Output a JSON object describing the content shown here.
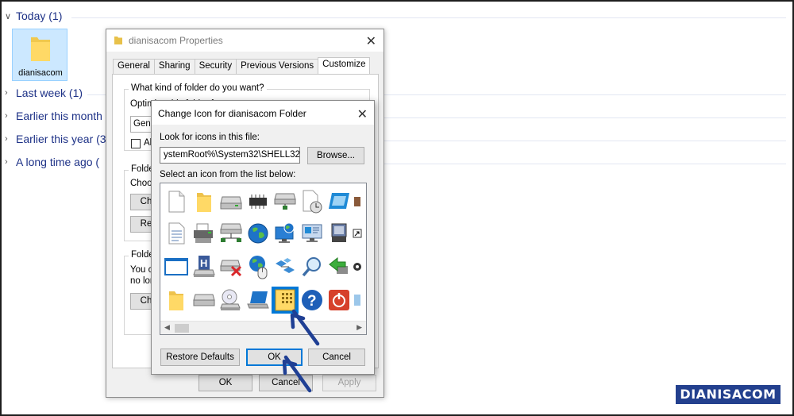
{
  "explorer": {
    "groups": [
      {
        "label": "Today (1)",
        "expanded": true
      },
      {
        "label": "Last week (1)",
        "expanded": false
      },
      {
        "label": "Earlier this month",
        "expanded": false
      },
      {
        "label": "Earlier this year (3",
        "expanded": false
      },
      {
        "label": "A long time ago (",
        "expanded": false
      }
    ],
    "folder": {
      "name": "dianisacom",
      "icon": "folder-icon"
    }
  },
  "properties": {
    "title": "dianisacom Properties",
    "tabs": [
      "General",
      "Sharing",
      "Security",
      "Previous Versions",
      "Customize"
    ],
    "active_tab": "Customize",
    "what_kind_label": "What kind of folder do you want?",
    "optimize_label": "Optimize this folder for:",
    "optimize_value": "General",
    "also_apply_label": "Also",
    "folder_pictures_label": "Folder",
    "choose_label": "Choos",
    "choose_file_button": "Ch",
    "restore_default_button": "Re",
    "folder_icons_label": "Folder",
    "folder_icons_text_1": "You c",
    "folder_icons_text_2": "no lon",
    "change_icon_button": "Ch",
    "ok_button": "OK",
    "cancel_button": "Cancel",
    "apply_button": "Apply"
  },
  "change_icon": {
    "title": "Change Icon for dianisacom Folder",
    "look_label": "Look for icons in this file:",
    "path_value": "ystemRoot%\\System32\\SHELL32.dll",
    "browse_button": "Browse...",
    "select_label": "Select an icon from the list below:",
    "selected_icon": "grid-folder-icon",
    "icons": [
      [
        "blank-file-icon",
        "folder-icon",
        "drive-icon",
        "chip-icon",
        "network-drive-icon",
        "clock-file-icon",
        "window-icon",
        "partial-icon"
      ],
      [
        "document-icon",
        "printer-icon",
        "network-icon",
        "globe-icon",
        "monitor-globe-icon",
        "display-icon",
        "computer-icon",
        "shortcut-icon"
      ],
      [
        "window-frame-icon",
        "floppy-icon",
        "error-drive-icon",
        "globe-mouse-icon",
        "network-blocks-icon",
        "search-icon",
        "recycle-arrow-icon",
        "partial-icon"
      ],
      [
        "folder-icon",
        "drive-small-icon",
        "cd-icon",
        "laptop-icon",
        "grid-folder-icon",
        "help-icon",
        "power-icon",
        "partial-icon"
      ]
    ],
    "restore_button": "Restore Defaults",
    "ok_button": "OK",
    "cancel_button": "Cancel"
  },
  "watermark": "DIANISACOM",
  "colors": {
    "accent": "#0078d7",
    "header_text": "#1e3287",
    "annotation_arrow": "#1f3f94",
    "watermark_bg": "#23408e"
  }
}
